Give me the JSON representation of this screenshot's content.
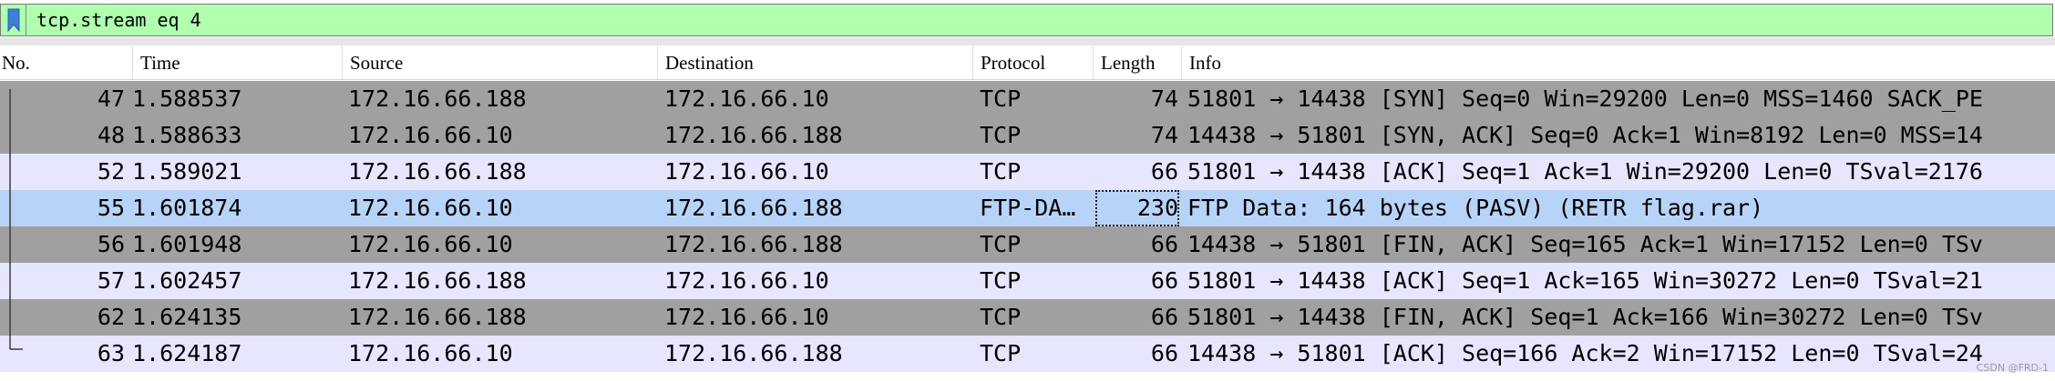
{
  "filter": {
    "value": "tcp.stream eq 4",
    "bookmark_icon": "bookmark-icon"
  },
  "columns": [
    "No.",
    "Time",
    "Source",
    "Destination",
    "Protocol",
    "Length",
    "Info"
  ],
  "packets": [
    {
      "no": "47",
      "time": "1.588537",
      "src": "172.16.66.188",
      "dst": "172.16.66.10",
      "proto": "TCP",
      "len": "74",
      "info": "51801 → 14438 [SYN] Seq=0 Win=29200 Len=0 MSS=1460 SACK_PE",
      "style": "gray"
    },
    {
      "no": "48",
      "time": "1.588633",
      "src": "172.16.66.10",
      "dst": "172.16.66.188",
      "proto": "TCP",
      "len": "74",
      "info": "14438 → 51801 [SYN, ACK] Seq=0 Ack=1 Win=8192 Len=0 MSS=14",
      "style": "gray"
    },
    {
      "no": "52",
      "time": "1.589021",
      "src": "172.16.66.188",
      "dst": "172.16.66.10",
      "proto": "TCP",
      "len": "66",
      "info": "51801 → 14438 [ACK] Seq=1 Ack=1 Win=29200 Len=0 TSval=2176",
      "style": "lav"
    },
    {
      "no": "55",
      "time": "1.601874",
      "src": "172.16.66.10",
      "dst": "172.16.66.188",
      "proto": "FTP-DA…",
      "len": "230",
      "info": "FTP Data: 164 bytes (PASV) (RETR flag.rar)",
      "style": "sel"
    },
    {
      "no": "56",
      "time": "1.601948",
      "src": "172.16.66.10",
      "dst": "172.16.66.188",
      "proto": "TCP",
      "len": "66",
      "info": "14438 → 51801 [FIN, ACK] Seq=165 Ack=1 Win=17152 Len=0 TSv",
      "style": "gray"
    },
    {
      "no": "57",
      "time": "1.602457",
      "src": "172.16.66.188",
      "dst": "172.16.66.10",
      "proto": "TCP",
      "len": "66",
      "info": "51801 → 14438 [ACK] Seq=1 Ack=165 Win=30272 Len=0 TSval=21",
      "style": "lav"
    },
    {
      "no": "62",
      "time": "1.624135",
      "src": "172.16.66.188",
      "dst": "172.16.66.10",
      "proto": "TCP",
      "len": "66",
      "info": "51801 → 14438 [FIN, ACK] Seq=1 Ack=166 Win=30272 Len=0 TSv",
      "style": "gray"
    },
    {
      "no": "63",
      "time": "1.624187",
      "src": "172.16.66.10",
      "dst": "172.16.66.188",
      "proto": "TCP",
      "len": "66",
      "info": "14438 → 51801 [ACK] Seq=166 Ack=2 Win=17152 Len=0 TSval=24",
      "style": "lav"
    }
  ],
  "watermark": "CSDN @FRD-1",
  "colors": {
    "filter_bg": "#afffaf",
    "row_gray": "#a0a0a0",
    "row_lavender": "#e7e6ff",
    "row_selected": "#b7d3f7"
  }
}
